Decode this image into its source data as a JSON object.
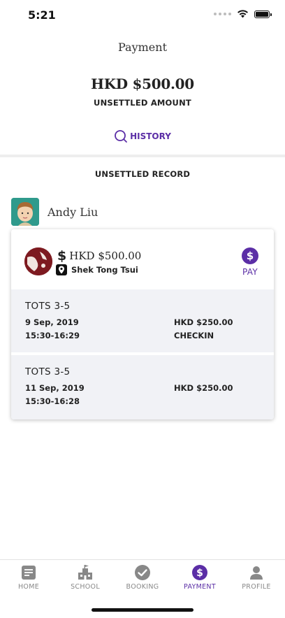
{
  "status_bar": {
    "time": "5:21"
  },
  "header": {
    "title": "Payment"
  },
  "summary": {
    "amount": "HKD $500.00",
    "label": "UNSETTLED AMOUNT",
    "history_label": "HISTORY"
  },
  "section_title": "UNSETTLED RECORD",
  "student": {
    "name": "Andy Liu"
  },
  "card": {
    "amount": "HKD $500.00",
    "location": "Shek Tong Tsui",
    "pay_label": "PAY",
    "sessions": [
      {
        "title": "TOTS 3-5",
        "date": "9 Sep,  2019",
        "time": "15:30-16:29",
        "amount": "HKD $250.00",
        "status": "CHECKIN"
      },
      {
        "title": "TOTS 3-5",
        "date": "11 Sep,  2019",
        "time": "15:30-16:28",
        "amount": "HKD $250.00",
        "status": ""
      }
    ]
  },
  "tabs": [
    {
      "label": "HOME",
      "icon": "home-icon",
      "active": false
    },
    {
      "label": "SCHOOL",
      "icon": "school-icon",
      "active": false
    },
    {
      "label": "BOOKING",
      "icon": "booking-icon",
      "active": false
    },
    {
      "label": "PAYMENT",
      "icon": "payment-icon",
      "active": true
    },
    {
      "label": "PROFILE",
      "icon": "profile-icon",
      "active": false
    }
  ],
  "colors": {
    "accent": "#5b2ea6",
    "inactive": "#888888",
    "session_bg": "#f1f2f6"
  }
}
